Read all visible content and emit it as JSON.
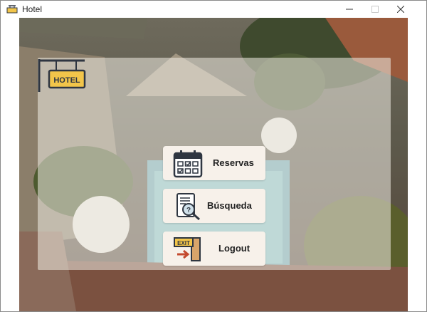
{
  "window": {
    "title": "Hotel",
    "controls": [
      "minimize",
      "maximize",
      "close"
    ]
  },
  "sign": {
    "text": "HOTEL"
  },
  "menu": [
    {
      "label": "Reservas",
      "icon": "calendar-icon"
    },
    {
      "label": "Búsqueda",
      "icon": "search-document-icon"
    },
    {
      "label": "Logout",
      "icon": "exit-door-icon",
      "icon_text": "EXIT"
    }
  ],
  "colors": {
    "sign_gold": "#f2c54a",
    "sign_dark": "#2f3641",
    "panel": "#f0ece4"
  }
}
